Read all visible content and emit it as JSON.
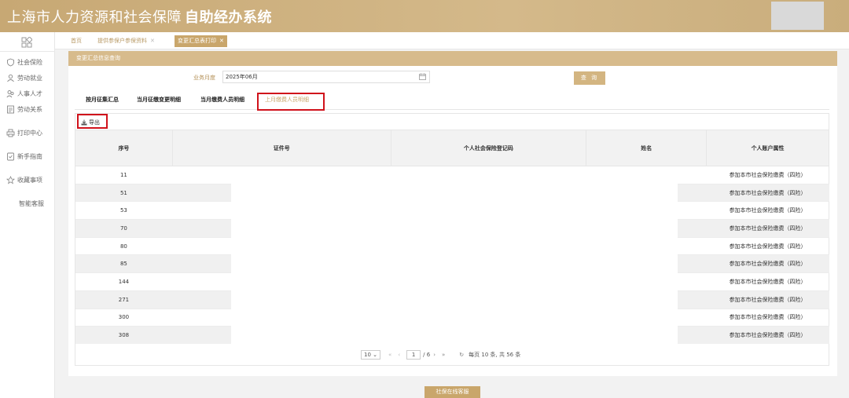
{
  "header": {
    "title_main": "上海市人力资源和社会保障",
    "title_bold": "自助经办系统"
  },
  "sidebar": {
    "items": [
      {
        "label": "社会保险",
        "icon": "shield-icon"
      },
      {
        "label": "劳动就业",
        "icon": "person-icon"
      },
      {
        "label": "人事人才",
        "icon": "people-icon"
      },
      {
        "label": "劳动关系",
        "icon": "document-icon"
      },
      {
        "label": "打印中心",
        "icon": "printer-icon"
      },
      {
        "label": "新手指南",
        "icon": "guide-icon"
      },
      {
        "label": "收藏事项",
        "icon": "star-icon"
      },
      {
        "label": "智能客服",
        "icon": ""
      }
    ]
  },
  "tabs": [
    {
      "label": "首页"
    },
    {
      "label": "提供参保户参保资料"
    },
    {
      "label": "变更汇总表打印"
    }
  ],
  "panel": {
    "title": "变更汇总信息查询"
  },
  "form": {
    "month_label": "业务月度",
    "month_value": "2025年06月",
    "query_label": "查 询"
  },
  "subtabs": [
    {
      "label": "按月征集汇总"
    },
    {
      "label": "当月征缴变更明细"
    },
    {
      "label": "当月缴费人员明细"
    },
    {
      "label": "上月缴费人员明细"
    }
  ],
  "toolbar": {
    "export_label": "导出"
  },
  "table": {
    "headers": [
      "序号",
      "证件号",
      "个人社会保险登记码",
      "姓名",
      "个人账户属性"
    ],
    "rows": [
      {
        "no": "11",
        "attr": "参加本市社会保险缴费（四险）"
      },
      {
        "no": "51",
        "attr": "参加本市社会保险缴费（四险）"
      },
      {
        "no": "53",
        "attr": "参加本市社会保险缴费（四险）"
      },
      {
        "no": "70",
        "attr": "参加本市社会保险缴费（四险）"
      },
      {
        "no": "80",
        "attr": "参加本市社会保险缴费（四险）"
      },
      {
        "no": "85",
        "attr": "参加本市社会保险缴费（四险）"
      },
      {
        "no": "144",
        "attr": "参加本市社会保险缴费（四险）"
      },
      {
        "no": "271",
        "attr": "参加本市社会保险缴费（四险）"
      },
      {
        "no": "300",
        "attr": "参加本市社会保险缴费（四险）"
      },
      {
        "no": "308",
        "attr": "参加本市社会保险缴费（四险）"
      }
    ]
  },
  "pager": {
    "page_size": "10",
    "current_page": "1",
    "total_pages": "/ 6",
    "summary": "每页 10 条, 共 56 条"
  },
  "float_button": {
    "label": "社保在线客服"
  },
  "colors": {
    "brand": "#c9a66b",
    "highlight": "#d0121b"
  }
}
